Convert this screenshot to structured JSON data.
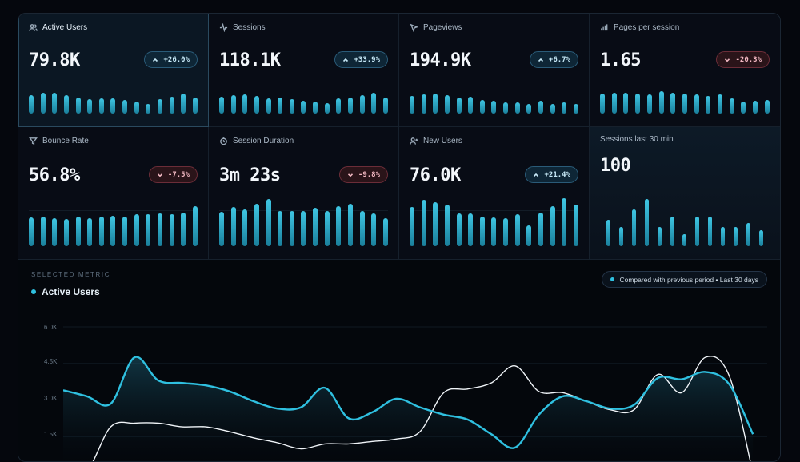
{
  "cards": [
    {
      "label": "Active Users",
      "value": "79.8K",
      "delta": "+26.0%",
      "trend": "up",
      "icon": "users-icon",
      "bars": [
        0.72,
        0.8,
        0.8,
        0.72,
        0.62,
        0.55,
        0.6,
        0.58,
        0.52,
        0.46,
        0.38,
        0.55,
        0.66,
        0.78,
        0.62
      ]
    },
    {
      "label": "Sessions",
      "value": "118.1K",
      "delta": "+33.9%",
      "trend": "up",
      "icon": "activity-icon",
      "bars": [
        0.66,
        0.72,
        0.76,
        0.7,
        0.58,
        0.62,
        0.56,
        0.5,
        0.46,
        0.4,
        0.58,
        0.64,
        0.72,
        0.8,
        0.62
      ]
    },
    {
      "label": "Pageviews",
      "value": "194.9K",
      "delta": "+6.7%",
      "trend": "up",
      "icon": "cursor-icon",
      "bars": [
        0.7,
        0.76,
        0.78,
        0.72,
        0.62,
        0.66,
        0.52,
        0.5,
        0.44,
        0.44,
        0.36,
        0.5,
        0.38,
        0.44,
        0.36
      ]
    },
    {
      "label": "Pages per session",
      "value": "1.65",
      "delta": "-20.3%",
      "trend": "down",
      "icon": "bar-chart-icon",
      "bars": [
        0.78,
        0.82,
        0.8,
        0.78,
        0.76,
        0.86,
        0.82,
        0.78,
        0.74,
        0.7,
        0.74,
        0.6,
        0.48,
        0.5,
        0.52
      ]
    },
    {
      "label": "Bounce Rate",
      "value": "56.8%",
      "delta": "-7.5%",
      "trend": "down",
      "icon": "funnel-icon",
      "bars": [
        0.6,
        0.62,
        0.58,
        0.56,
        0.62,
        0.58,
        0.62,
        0.64,
        0.62,
        0.66,
        0.66,
        0.68,
        0.66,
        0.7,
        0.84
      ]
    },
    {
      "label": "Session Duration",
      "value": "3m 23s",
      "delta": "-9.8%",
      "trend": "down",
      "icon": "clock-icon",
      "bars": [
        0.72,
        0.82,
        0.76,
        0.88,
        0.98,
        0.74,
        0.74,
        0.74,
        0.8,
        0.74,
        0.84,
        0.88,
        0.74,
        0.68,
        0.58
      ]
    },
    {
      "label": "New Users",
      "value": "76.0K",
      "delta": "+21.4%",
      "trend": "up",
      "icon": "user-plus-icon",
      "bars": [
        0.82,
        0.96,
        0.92,
        0.86,
        0.68,
        0.68,
        0.62,
        0.6,
        0.58,
        0.66,
        0.44,
        0.7,
        0.84,
        1.0,
        0.86
      ]
    },
    {
      "label": "Sessions last 30 min",
      "value": "100",
      "delta": "",
      "trend": "",
      "icon": "",
      "bars": [
        0.3,
        0.22,
        0.42,
        0.54,
        0.22,
        0.34,
        0.14,
        0.34,
        0.34,
        0.22,
        0.22,
        0.26,
        0.18
      ]
    }
  ],
  "section": {
    "label": "SELECTED METRIC",
    "metric": "Active Users",
    "compare": "Compared with previous period • Last 30 days",
    "accent": "#2fc0e0",
    "yticks": [
      "6.0K",
      "4.5K",
      "3.0K",
      "1.5K"
    ]
  },
  "chart_data": {
    "type": "line",
    "title": "Active Users",
    "yticks": [
      "6.0K",
      "4.5K",
      "3.0K",
      "1.5K"
    ],
    "ylim": [
      0,
      6000
    ],
    "series": [
      {
        "name": "Active Users",
        "values": [
          3400,
          3150,
          2850,
          4750,
          3800,
          3700,
          3600,
          3350,
          2950,
          2650,
          2700,
          3500,
          2250,
          2500,
          3050,
          2700,
          2400,
          2200,
          1600,
          1050,
          2400,
          3150,
          2950,
          2650,
          2800,
          3900,
          3850,
          4150,
          3650,
          1600
        ]
      },
      {
        "name": "",
        "values": [
          0,
          100,
          1900,
          2050,
          2050,
          1900,
          1900,
          1700,
          1450,
          1250,
          1000,
          1200,
          1200,
          1300,
          1400,
          1700,
          3300,
          3450,
          3700,
          4400,
          3350,
          3300,
          2950,
          2600,
          2600,
          4050,
          3300,
          4750,
          4000,
          0
        ]
      }
    ]
  }
}
